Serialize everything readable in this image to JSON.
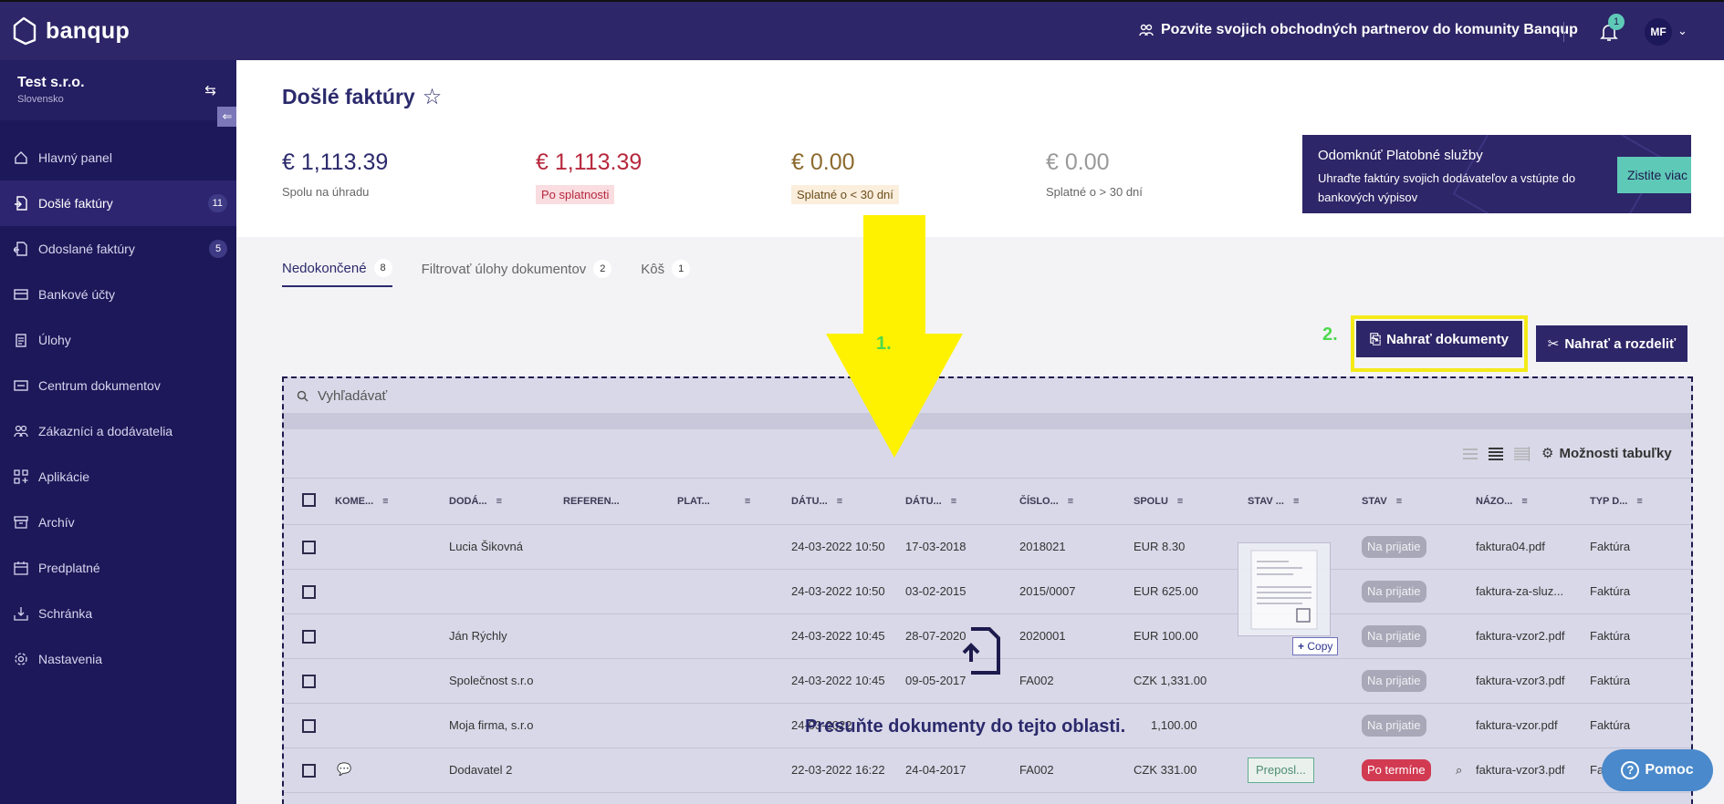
{
  "brand": {
    "name": "banqup"
  },
  "topbar": {
    "invite_text": "Pozvite svojich obchodných partnerov do komunity Banqup",
    "notification_count": "1",
    "user_initials": "MF"
  },
  "sidebar": {
    "company_name": "Test s.r.o.",
    "company_country": "Slovensko",
    "items": [
      {
        "label": "Hlavný panel",
        "icon": "dashboard-icon",
        "badge": ""
      },
      {
        "label": "Došlé faktúry",
        "icon": "incoming-invoice-icon",
        "badge": "11"
      },
      {
        "label": "Odoslané faktúry",
        "icon": "outgoing-invoice-icon",
        "badge": "5"
      },
      {
        "label": "Bankové účty",
        "icon": "bank-card-icon",
        "badge": ""
      },
      {
        "label": "Úlohy",
        "icon": "tasks-icon",
        "badge": ""
      },
      {
        "label": "Centrum dokumentov",
        "icon": "document-center-icon",
        "badge": ""
      },
      {
        "label": "Zákazníci a dodávatelia",
        "icon": "contacts-icon",
        "badge": ""
      },
      {
        "label": "Aplikácie",
        "icon": "apps-icon",
        "badge": ""
      },
      {
        "label": "Archív",
        "icon": "archive-icon",
        "badge": ""
      },
      {
        "label": "Predplatné",
        "icon": "subscription-icon",
        "badge": ""
      },
      {
        "label": "Schránka",
        "icon": "inbox-icon",
        "badge": ""
      },
      {
        "label": "Nastavenia",
        "icon": "settings-icon",
        "badge": ""
      }
    ]
  },
  "page": {
    "title": "Došlé faktúry"
  },
  "stats": [
    {
      "value": "€ 1,113.39",
      "label": "Spolu na úhradu"
    },
    {
      "value": "€ 1,113.39",
      "label": "Po splatnosti"
    },
    {
      "value": "€ 0.00",
      "label": "Splatné o < 30 dní"
    },
    {
      "value": "€ 0.00",
      "label": "Splatné o > 30 dní"
    }
  ],
  "promo": {
    "title": "Odomknúť Platobné služby",
    "body": "Uhraďte faktúry svojich dodávateľov a vstúpte do bankových výpisov",
    "button": "Zistite viac"
  },
  "tabs": [
    {
      "label": "Nedokončené",
      "count": "8"
    },
    {
      "label": "Filtrovať úlohy dokumentov",
      "count": "2"
    },
    {
      "label": "Kôš",
      "count": "1"
    }
  ],
  "steps": {
    "one": "1.",
    "two": "2."
  },
  "actions": {
    "upload": "Nahrať dokumenty",
    "upload_split": "Nahrať a rozdeliť"
  },
  "search": {
    "placeholder": "Vyhľadávať"
  },
  "table_tools": {
    "options_label": "Možnosti tabuľky"
  },
  "columns": [
    "KOME...",
    "DODÁ...",
    "REFEREN...",
    "PLAT...",
    "DÁTU...",
    "DÁTU...",
    "ČÍSLO...",
    "SPOLU",
    "STAV ...",
    "STAV",
    "NÁZO...",
    "TYP D..."
  ],
  "rows": [
    {
      "comment": "",
      "supplier": "Lucia Šikovná",
      "received": "24-03-2022 10:50",
      "issued": "17-03-2018",
      "number": "2018021",
      "total": "EUR 8.30",
      "workflow": "",
      "status": "Na prijatie",
      "name": "faktura04.pdf",
      "type": "Faktúra"
    },
    {
      "comment": "",
      "supplier": "",
      "received": "24-03-2022 10:50",
      "issued": "03-02-2015",
      "number": "2015/0007",
      "total": "EUR 625.00",
      "workflow": "",
      "status": "Na prijatie",
      "name": "faktura-za-sluz...",
      "type": "Faktúra"
    },
    {
      "comment": "",
      "supplier": "Ján Rýchly",
      "received": "24-03-2022 10:45",
      "issued": "28-07-2020",
      "number": "2020001",
      "total": "EUR 100.00",
      "workflow": "",
      "status": "Na prijatie",
      "name": "faktura-vzor2.pdf",
      "type": "Faktúra"
    },
    {
      "comment": "",
      "supplier": "Společnost s.r.o",
      "received": "24-03-2022 10:45",
      "issued": "09-05-2017",
      "number": "FA002",
      "total": "CZK 1,331.00",
      "workflow": "",
      "status": "Na prijatie",
      "name": "faktura-vzor3.pdf",
      "type": "Faktúra"
    },
    {
      "comment": "",
      "supplier": "Moja firma, s.r.o",
      "received": "24-03-2022",
      "issued": "",
      "number": "",
      "total": "1,100.00",
      "workflow": "",
      "status": "Na prijatie",
      "name": "faktura-vzor.pdf",
      "type": "Faktúra"
    },
    {
      "comment": "comment-icon",
      "supplier": "Dodavatel 2",
      "received": "22-03-2022 16:22",
      "issued": "24-04-2017",
      "number": "FA002",
      "total": "CZK 331.00",
      "workflow": "Preposl...",
      "status": "Po termíne",
      "name": "faktura-vzor3.pdf",
      "type": "Faktúra"
    }
  ],
  "drag": {
    "copy_label": "Copy"
  },
  "drop_text": "Presuňte dokumenty do tejto oblasti.",
  "help": {
    "label": "Pomoc"
  },
  "colors": {
    "primary": "#2d2668",
    "accent": "#5fc9b8",
    "highlight": "#f4ea18",
    "step": "#4dd94d",
    "danger": "#d23a52"
  }
}
